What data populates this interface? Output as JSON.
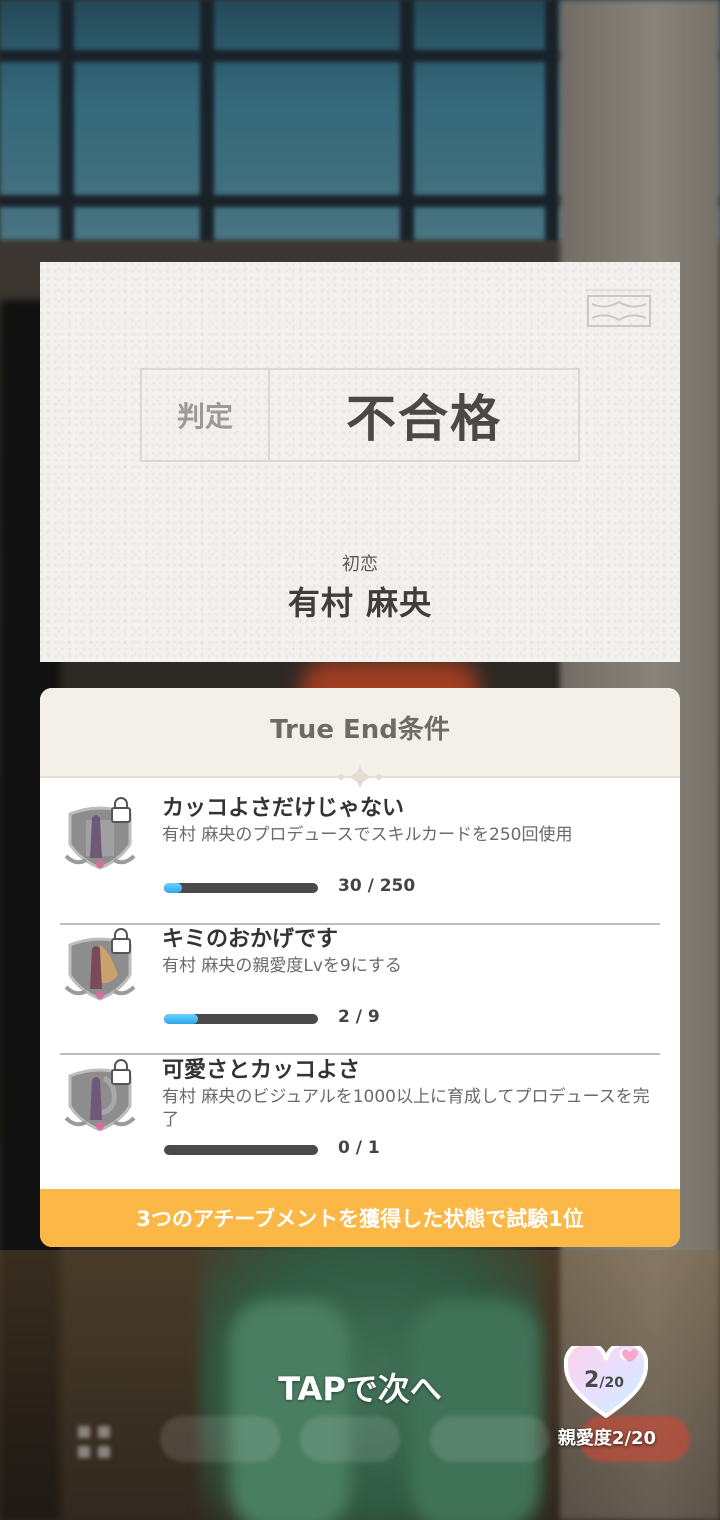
{
  "result": {
    "judge_label": "判定",
    "judge_value": "不合格",
    "course": "初恋",
    "idol_name": "有村 麻央"
  },
  "true_end": {
    "title": "True End条件",
    "achievements": [
      {
        "title": "カッコよさだけじゃない",
        "description": "有村 麻央のプロデュースでスキルカードを250回使用",
        "progress_text": "30 / 250",
        "progress": 0.12,
        "icon": "locked-achievement-badge-icon"
      },
      {
        "title": "キミのおかげです",
        "description": "有村 麻央の親愛度Lvを9にする",
        "progress_text": "2 / 9",
        "progress": 0.22,
        "icon": "locked-achievement-badge-icon"
      },
      {
        "title": "可愛さとカッコよさ",
        "description": "有村 麻央のビジュアルを1000以上に育成してプロデュースを完了",
        "progress_text": "0 / 1",
        "progress": 0,
        "icon": "locked-achievement-badge-icon"
      }
    ],
    "footer": "3つのアチーブメントを獲得した状態で試験1位"
  },
  "hud": {
    "tap_next": "TAPで次へ",
    "affection_value": "2",
    "affection_max": "/20",
    "affection_label": "親愛度2/20"
  },
  "colors": {
    "footer_bg": "#fbb846",
    "progress_fill": "#2aa8f0",
    "progress_track": "#4a4a4a"
  }
}
